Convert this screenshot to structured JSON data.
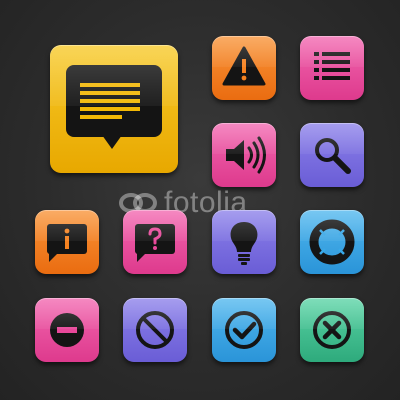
{
  "watermark": {
    "text": "fotolia",
    "icon": "fotolia-logo"
  },
  "colors": {
    "background": "#2c2c2c",
    "yellow": "#f2b705",
    "orange": "#f58220",
    "pink": "#e8489a",
    "purple": "#7a6ee0",
    "blue": "#38a8e8",
    "green": "#3fbf8f",
    "glyph": "#111111",
    "glyph_accent": "#f2b705"
  },
  "icons": [
    {
      "name": "speech-bubble-text-icon",
      "color": "yellow"
    },
    {
      "name": "warning-icon",
      "color": "orange"
    },
    {
      "name": "list-icon",
      "color": "pink"
    },
    {
      "name": "speaker-volume-icon",
      "color": "pink"
    },
    {
      "name": "search-icon",
      "color": "purple"
    },
    {
      "name": "info-bubble-icon",
      "color": "orange"
    },
    {
      "name": "question-bubble-icon",
      "color": "pink"
    },
    {
      "name": "lightbulb-icon",
      "color": "purple"
    },
    {
      "name": "lifebuoy-icon",
      "color": "blue"
    },
    {
      "name": "minus-circle-icon",
      "color": "pink"
    },
    {
      "name": "forbidden-icon",
      "color": "purple"
    },
    {
      "name": "check-circle-icon",
      "color": "blue"
    },
    {
      "name": "close-circle-icon",
      "color": "green"
    }
  ]
}
